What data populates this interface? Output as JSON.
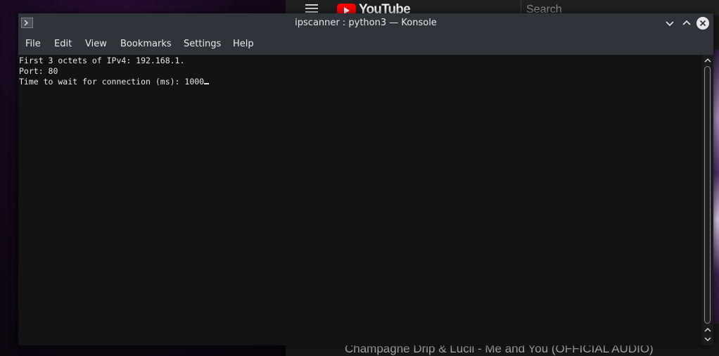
{
  "background": {
    "browser": {
      "logo_text": "YouTube",
      "search_placeholder": "Search",
      "video_title": "Champagne Drip & Lucii - Me and You (OFFICIAL AUDIO)"
    }
  },
  "window": {
    "title": "ipscanner : python3 — Konsole",
    "menu": [
      "File",
      "Edit",
      "View",
      "Bookmarks",
      "Settings",
      "Help"
    ]
  },
  "terminal": {
    "lines": [
      "First 3 octets of IPv4: 192.168.1.",
      "Port: 80",
      "Time to wait for connection (ms): 1000"
    ]
  },
  "colors": {
    "titlebar": "#2f343a",
    "terminal_bg": "#131313",
    "terminal_fg": "#e6e6e6",
    "youtube_red": "#ff0000"
  }
}
